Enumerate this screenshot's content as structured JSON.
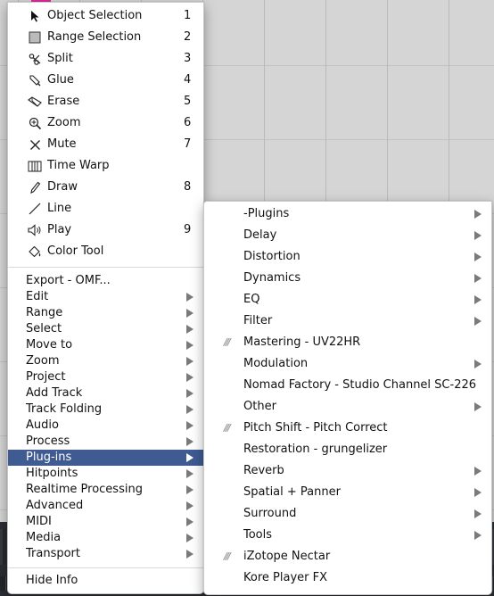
{
  "main_menu": {
    "tools": [
      {
        "label": "Object Selection",
        "key": "1",
        "icon": "pointer-icon"
      },
      {
        "label": "Range Selection",
        "key": "2",
        "icon": "range-square-icon"
      },
      {
        "label": "Split",
        "key": "3",
        "icon": "scissors-icon"
      },
      {
        "label": "Glue",
        "key": "4",
        "icon": "glue-tube-icon"
      },
      {
        "label": "Erase",
        "key": "5",
        "icon": "eraser-icon"
      },
      {
        "label": "Zoom",
        "key": "6",
        "icon": "magnifier-icon"
      },
      {
        "label": "Mute",
        "key": "7",
        "icon": "x-mark-icon"
      },
      {
        "label": "Time Warp",
        "key": "",
        "icon": "time-warp-icon"
      },
      {
        "label": "Draw",
        "key": "8",
        "icon": "pencil-icon"
      },
      {
        "label": "Line",
        "key": "",
        "icon": "line-icon"
      },
      {
        "label": "Play",
        "key": "9",
        "icon": "speaker-icon"
      },
      {
        "label": "Color Tool",
        "key": "",
        "icon": "paint-bucket-icon"
      }
    ],
    "commands": [
      {
        "label": "Export - OMF...",
        "submenu": false
      },
      {
        "label": "Edit",
        "submenu": true
      },
      {
        "label": "Range",
        "submenu": true
      },
      {
        "label": "Select",
        "submenu": true
      },
      {
        "label": "Move to",
        "submenu": true
      },
      {
        "label": "Zoom",
        "submenu": true
      },
      {
        "label": "Project",
        "submenu": true
      },
      {
        "label": "Add Track",
        "submenu": true
      },
      {
        "label": "Track Folding",
        "submenu": true
      },
      {
        "label": "Audio",
        "submenu": true
      },
      {
        "label": "Process",
        "submenu": true
      },
      {
        "label": "Plug-ins",
        "submenu": true,
        "highlighted": true
      },
      {
        "label": "Hitpoints",
        "submenu": true
      },
      {
        "label": "Realtime Processing",
        "submenu": true
      },
      {
        "label": "Advanced",
        "submenu": true
      },
      {
        "label": "MIDI",
        "submenu": true
      },
      {
        "label": "Media",
        "submenu": true
      },
      {
        "label": "Transport",
        "submenu": true
      }
    ],
    "footer": {
      "label": "Hide Info"
    }
  },
  "plugins_submenu": {
    "items": [
      {
        "label": "-Plugins",
        "submenu": true,
        "marked": false
      },
      {
        "label": "Delay",
        "submenu": true,
        "marked": false
      },
      {
        "label": "Distortion",
        "submenu": true,
        "marked": false
      },
      {
        "label": "Dynamics",
        "submenu": true,
        "marked": false
      },
      {
        "label": "EQ",
        "submenu": true,
        "marked": false
      },
      {
        "label": "Filter",
        "submenu": true,
        "marked": false
      },
      {
        "label": "Mastering - UV22HR",
        "submenu": false,
        "marked": true
      },
      {
        "label": "Modulation",
        "submenu": true,
        "marked": false
      },
      {
        "label": "Nomad Factory - Studio Channel SC-226",
        "submenu": false,
        "marked": false
      },
      {
        "label": "Other",
        "submenu": true,
        "marked": false
      },
      {
        "label": "Pitch Shift - Pitch Correct",
        "submenu": false,
        "marked": true
      },
      {
        "label": "Restoration - grungelizer",
        "submenu": false,
        "marked": false
      },
      {
        "label": "Reverb",
        "submenu": true,
        "marked": false
      },
      {
        "label": "Spatial + Panner",
        "submenu": true,
        "marked": false
      },
      {
        "label": "Surround",
        "submenu": true,
        "marked": false
      },
      {
        "label": "Tools",
        "submenu": true,
        "marked": false
      },
      {
        "label": "iZotope Nectar",
        "submenu": false,
        "marked": true
      },
      {
        "label": "Kore Player FX",
        "submenu": false,
        "marked": false
      }
    ]
  },
  "colors": {
    "highlight": "#3f5b92",
    "accent_pink": "#e0289b"
  }
}
